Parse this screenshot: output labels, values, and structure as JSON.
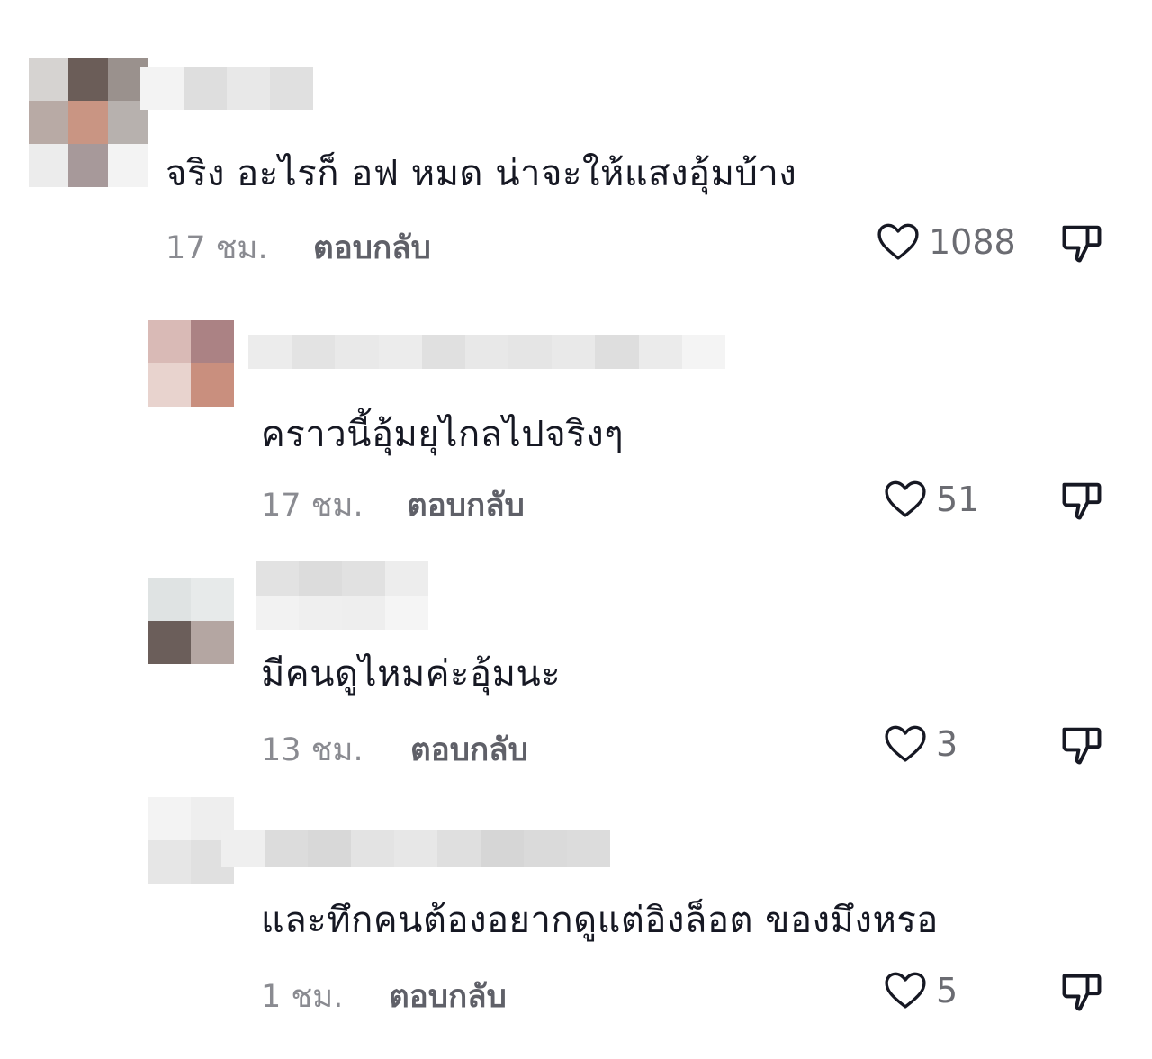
{
  "comments": [
    {
      "text": "จริง อะไรก็ อฟ หมด น่าจะให้แสงอุ้มบ้าง",
      "time": "17 ชม.",
      "reply_label": "ตอบกลับ",
      "likes": "1088"
    },
    {
      "text": "คราวนี้อุ้มยุไกลไปจริงๆ",
      "time": "17 ชม.",
      "reply_label": "ตอบกลับ",
      "likes": "51"
    },
    {
      "text": "มีคนดูไหมค่ะอุ้มนะ",
      "time": "13 ชม.",
      "reply_label": "ตอบกลับ",
      "likes": "3"
    },
    {
      "text": "และทึกคนต้องอยากดูแต่อิงล็อต ของมึงหรอ",
      "time": "1 ชม.",
      "reply_label": "ตอบกลับ",
      "likes": "5"
    }
  ],
  "icons": {
    "like": "heart-outline-icon",
    "dislike": "thumbs-down-outline-icon"
  },
  "colors": {
    "text": "#161823",
    "meta": "#8a8b91",
    "icon": "#161823"
  }
}
